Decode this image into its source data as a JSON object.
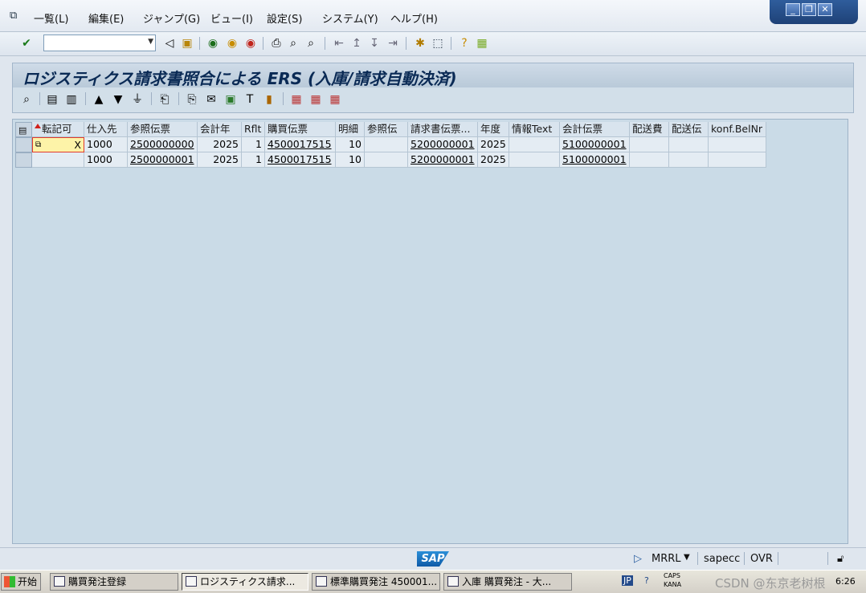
{
  "menu": {
    "items": [
      "一覧(L)",
      "編集(E)",
      "ジャンプ(G)",
      "ビュー(I)",
      "設定(S)",
      "システム(Y)",
      "ヘルプ(H)"
    ]
  },
  "toolbar": {
    "command_field_value": ""
  },
  "title": "ロジスティクス請求書照合による ERS (入庫/請求自動決済)",
  "grid": {
    "columns": [
      "転記可",
      "仕入先",
      "参照伝票",
      "会計年",
      "Rflt",
      "購買伝票",
      "明細",
      "参照伝",
      "請求書伝票...",
      "年度",
      "情報Text",
      "会計伝票",
      "配送費",
      "配送伝",
      "konf.BelNr"
    ],
    "rows": [
      [
        "X",
        "1000",
        "2500000000",
        "2025",
        "1",
        "4500017515",
        "10",
        "",
        "5200000001",
        "2025",
        "",
        "5100000001",
        "",
        "",
        ""
      ],
      [
        "",
        "1000",
        "2500000001",
        "2025",
        "1",
        "4500017515",
        "10",
        "",
        "5200000001",
        "2025",
        "",
        "5100000001",
        "",
        "",
        ""
      ]
    ]
  },
  "statusbar": {
    "logo": "SAP",
    "transaction": "MRRL",
    "server": "sapecc",
    "mode": "OVR"
  },
  "taskbar": {
    "start": "开始",
    "items": [
      "購買発注登録",
      "ロジスティクス請求...",
      "標準購買発注 450001...",
      "入庫 購買発注 - 大..."
    ],
    "tray": {
      "lang": "JP",
      "caps": "CAPS",
      "kana": "KANA",
      "time": "6:26",
      "watermark": "CSDN @东京老树根"
    }
  }
}
